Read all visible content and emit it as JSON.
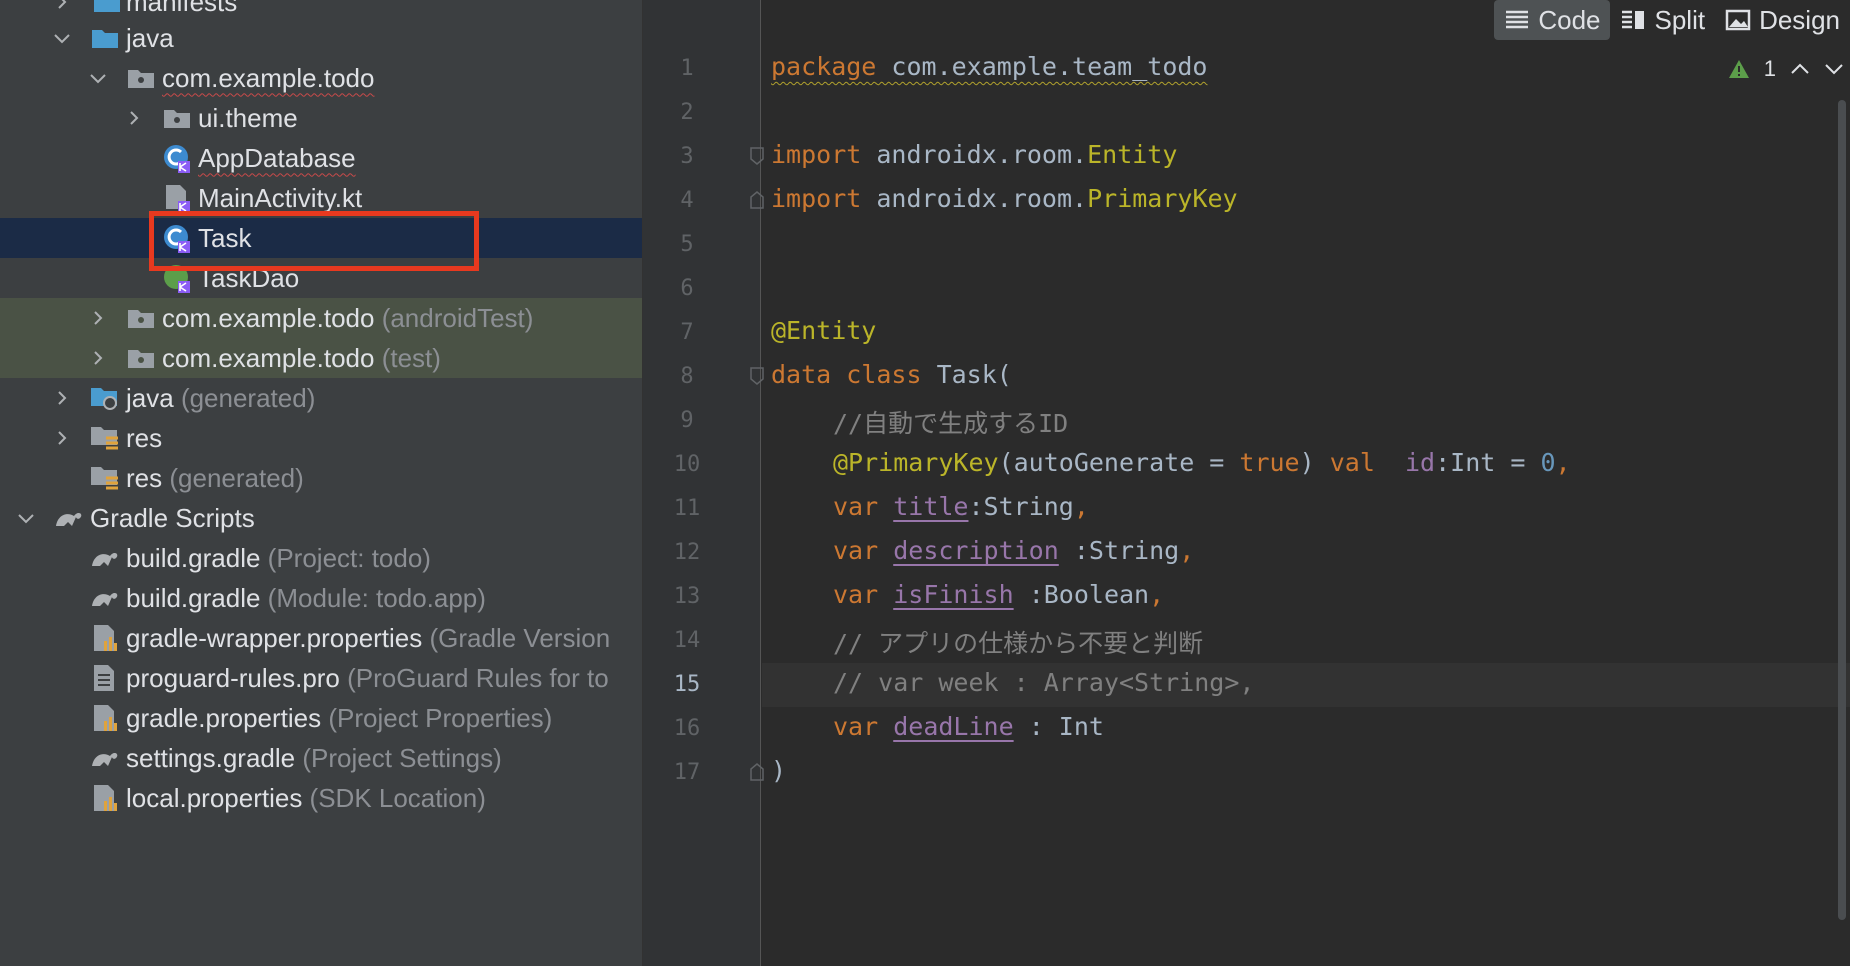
{
  "tree": {
    "rows": [
      {
        "label": "manifests",
        "hint": ""
      },
      {
        "label": "java",
        "hint": ""
      },
      {
        "label": "com.example.todo",
        "hint": ""
      },
      {
        "label": "ui.theme",
        "hint": ""
      },
      {
        "label": "AppDatabase",
        "hint": ""
      },
      {
        "label": "MainActivity.kt",
        "hint": ""
      },
      {
        "label": "Task",
        "hint": ""
      },
      {
        "label": "TaskDao",
        "hint": ""
      },
      {
        "label": "com.example.todo",
        "hint": "(androidTest)"
      },
      {
        "label": "com.example.todo",
        "hint": "(test)"
      },
      {
        "label": "java",
        "hint": "(generated)"
      },
      {
        "label": "res",
        "hint": ""
      },
      {
        "label": "res",
        "hint": "(generated)"
      },
      {
        "label": "Gradle Scripts",
        "hint": ""
      },
      {
        "label": "build.gradle",
        "hint": "(Project: todo)"
      },
      {
        "label": "build.gradle",
        "hint": "(Module: todo.app)"
      },
      {
        "label": "gradle-wrapper.properties",
        "hint": "(Gradle Version"
      },
      {
        "label": "proguard-rules.pro",
        "hint": "(ProGuard Rules for to"
      },
      {
        "label": "gradle.properties",
        "hint": "(Project Properties)"
      },
      {
        "label": "settings.gradle",
        "hint": "(Project Settings)"
      },
      {
        "label": "local.properties",
        "hint": "(SDK Location)"
      }
    ]
  },
  "viewbar": {
    "code": "Code",
    "split": "Split",
    "design": "Design"
  },
  "inspection": {
    "warnings": "1"
  },
  "editor": {
    "line_numbers": [
      "1",
      "2",
      "3",
      "4",
      "5",
      "6",
      "7",
      "8",
      "9",
      "10",
      "11",
      "12",
      "13",
      "14",
      "15",
      "16",
      "17"
    ],
    "current_line": "15",
    "l1": {
      "kw": "package",
      "rest": " com.example.team_todo"
    },
    "l3": {
      "kw": "import",
      "pkg": " androidx.room.",
      "cls": "Entity"
    },
    "l4": {
      "kw": "import",
      "pkg": " androidx.room.",
      "cls": "PrimaryKey"
    },
    "l7": {
      "ann": "@Entity"
    },
    "l8": {
      "kw": "data class",
      "rest": " Task("
    },
    "l9": {
      "cmt": "//自動で生成するID"
    },
    "l10": {
      "ann": "@PrimaryKey",
      "a1": "(autoGenerate = ",
      "kwtrue": "true",
      "a2": ") ",
      "kwval": "val",
      "sp": "  ",
      "prop": "id",
      "t": ":Int = ",
      "num": "0",
      "comma": ","
    },
    "l11": {
      "kw": "var",
      "prop": "title",
      "t": ":String",
      "comma": ","
    },
    "l12": {
      "kw": "var",
      "prop": "description",
      "t": " :String",
      "comma": ","
    },
    "l13": {
      "kw": "var",
      "prop": "isFinish",
      "t": " :Boolean",
      "comma": ","
    },
    "l14": {
      "cmt": "// アプリの仕様から不要と判断"
    },
    "l15": {
      "cmt": "// var week : Array<String>,"
    },
    "l16": {
      "kw": "var",
      "prop": "deadLine",
      "t": " : Int"
    },
    "l17": {
      "rest": ")"
    }
  },
  "colors": {
    "selection": "#1b2b46",
    "highlight_border": "#e8391f",
    "keyword": "#cc7832",
    "annotation": "#bbb529",
    "property": "#9876aa",
    "number": "#6897bb",
    "comment": "#808080"
  }
}
